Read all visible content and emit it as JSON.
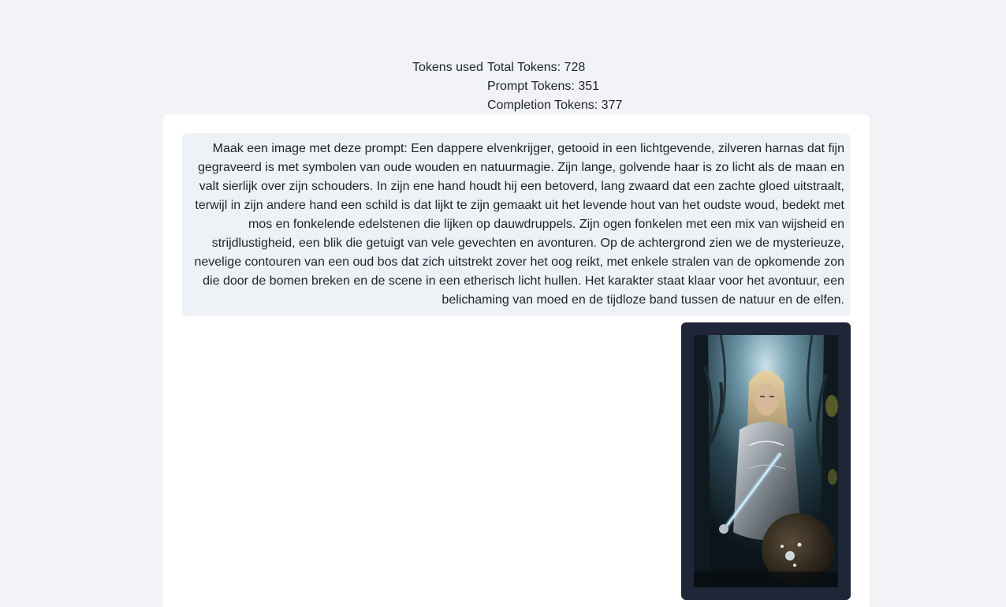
{
  "tokens": {
    "label": "Tokens used",
    "total": "Total Tokens: 728",
    "prompt": "Prompt Tokens: 351",
    "completion": "Completion Tokens: 377"
  },
  "message": {
    "prompt_text": "Maak een image met deze prompt: Een dappere elvenkrijger, getooid in een lichtgevende, zilveren harnas dat fijn gegraveerd is met symbolen van oude wouden en natuurmagie. Zijn lange, golvende haar is zo licht als de maan en valt sierlijk over zijn schouders. In zijn ene hand houdt hij een betoverd, lang zwaard dat een zachte gloed uitstraalt, terwijl in zijn andere hand een schild is dat lijkt te zijn gemaakt uit het levende hout van het oudste woud, bedekt met mos en fonkelende edelstenen die lijken op dauwdruppels. Zijn ogen fonkelen met een mix van wijsheid en strijdlustigheid, een blik die getuigt van vele gevechten en avonturen. Op de achtergrond zien we de mysterieuze, nevelige contouren van een oud bos dat zich uitstrekt zover het oog reikt, met enkele stralen van de opkomende zon die door de bomen breken en de scene in een etherisch licht hullen. Het karakter staat klaar voor het avontuur, een belichaming van moed en de tijdloze band tussen de natuur en de elfen."
  },
  "colors": {
    "page_background": "#f1f3f6",
    "card_background": "#ffffff",
    "prompt_bubble": "#eef2f7",
    "image_frame": "#1e2637"
  }
}
